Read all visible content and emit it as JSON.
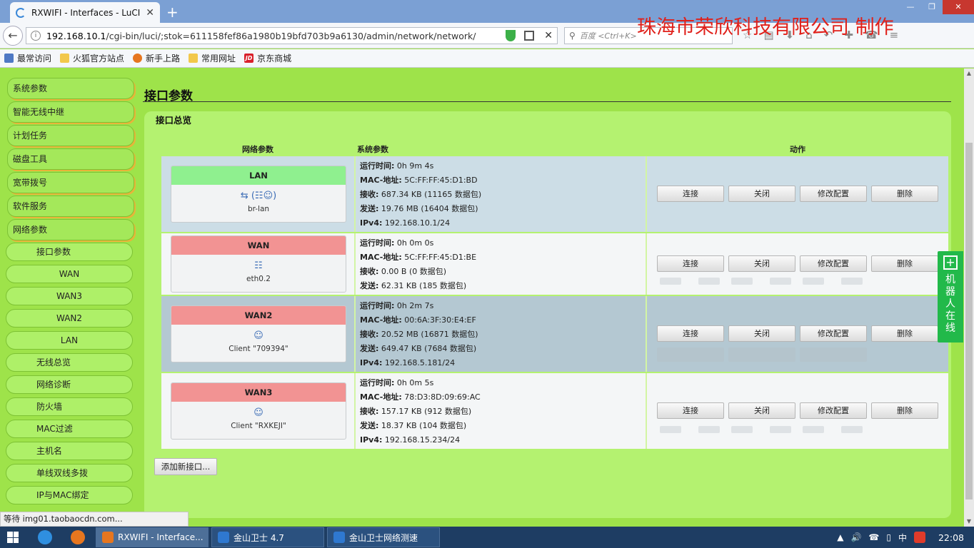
{
  "browser": {
    "tab_title": "RXWIFI - Interfaces - LuCI",
    "new_tab": "+",
    "win_min": "—",
    "win_restore": "❐",
    "win_close": "✕",
    "url_host": "192.168.10.1",
    "url_path": "/cgi-bin/luci/;stok=611158fef86a1980b19bfd703b9a6130/admin/network/network/",
    "search_placeholder": "百度 <Ctrl+K>",
    "bookmarks": [
      "最常访问",
      "火狐官方站点",
      "新手上路",
      "常用网址",
      "京东商城"
    ]
  },
  "watermark": "珠海市荣欣科技有限公司 制作",
  "sidebar": {
    "top_items": [
      "系统参数",
      "智能无线中继",
      "计划任务",
      "磁盘工具",
      "宽带拨号",
      "软件服务",
      "网络参数"
    ],
    "sub_items": [
      "接口参数",
      "WAN",
      "WAN3",
      "WAN2",
      "LAN",
      "无线总览",
      "网络诊断",
      "防火墙",
      "MAC过滤",
      "主机名",
      "单线双线多拨",
      "IP与MAC绑定"
    ]
  },
  "main": {
    "title": "接口参数",
    "legend": "接口总览",
    "col_net": "网络参数",
    "col_sys": "系统参数",
    "col_action": "动作",
    "add_button": "添加新接口...",
    "labels": {
      "uptime": "运行时间:",
      "mac": "MAC-地址:",
      "rx": "接收:",
      "tx": "发送:",
      "ipv4": "IPv4:"
    },
    "buttons": {
      "connect": "连接",
      "close": "关闭",
      "edit": "修改配置",
      "delete": "删除"
    },
    "interfaces": [
      {
        "name": "LAN",
        "status": "up",
        "device": "br-lan",
        "icons": "⇆ (☷☺)",
        "uptime": "0h 9m 4s",
        "mac": "5C:FF:FF:45:D1:BD",
        "rx": "687.34 KB (11165 数据包)",
        "tx": "19.76 MB (16404 数据包)",
        "ipv4": "192.168.10.1/24"
      },
      {
        "name": "WAN",
        "status": "down",
        "device": "eth0.2",
        "icons": "☷",
        "uptime": "0h 0m 0s",
        "mac": "5C:FF:FF:45:D1:BE",
        "rx": "0.00 B (0 数据包)",
        "tx": "62.31 KB (185 数据包)",
        "ipv4": ""
      },
      {
        "name": "WAN2",
        "status": "down",
        "device": "Client \"709394\"",
        "icons": "☺",
        "uptime": "0h 2m 7s",
        "mac": "00:6A:3F:30:E4:EF",
        "rx": "20.52 MB (16871 数据包)",
        "tx": "649.47 KB (7684 数据包)",
        "ipv4": "192.168.5.181/24"
      },
      {
        "name": "WAN3",
        "status": "down",
        "device": "Client \"RXKEJI\"",
        "icons": "☺",
        "uptime": "0h 0m 5s",
        "mac": "78:D3:8D:09:69:AC",
        "rx": "157.17 KB (912 数据包)",
        "tx": "18.37 KB (104 数据包)",
        "ipv4": "192.168.15.234/24"
      }
    ]
  },
  "robot_widget": {
    "icon": "+",
    "label": "机器人在线"
  },
  "status_text": "等待 img01.taobaocdn.com...",
  "taskbar": {
    "tasks": [
      "RXWIFI - Interface...",
      "金山卫士 4.7",
      "金山卫士网络测速"
    ],
    "ime": "中",
    "clock": "22:08"
  },
  "colors": {
    "page_bg": "#9ee34a",
    "up_header": "#8ff08f",
    "down_header": "#f29393",
    "watermark": "#e0201a",
    "taskbar": "#1e3d63"
  }
}
